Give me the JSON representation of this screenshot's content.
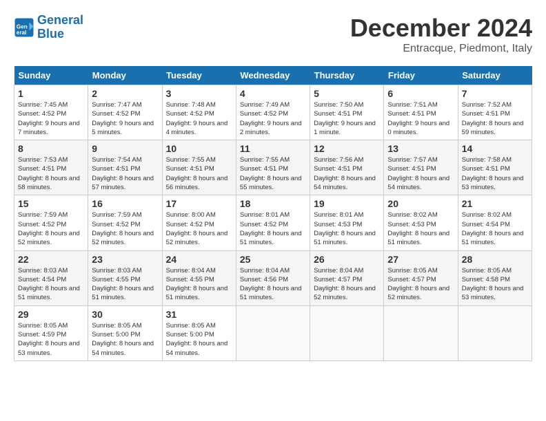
{
  "logo": {
    "line1": "General",
    "line2": "Blue"
  },
  "title": "December 2024",
  "subtitle": "Entracque, Piedmont, Italy",
  "weekdays": [
    "Sunday",
    "Monday",
    "Tuesday",
    "Wednesday",
    "Thursday",
    "Friday",
    "Saturday"
  ],
  "weeks": [
    [
      {
        "day": "1",
        "info": "Sunrise: 7:45 AM\nSunset: 4:52 PM\nDaylight: 9 hours and 7 minutes."
      },
      {
        "day": "2",
        "info": "Sunrise: 7:47 AM\nSunset: 4:52 PM\nDaylight: 9 hours and 5 minutes."
      },
      {
        "day": "3",
        "info": "Sunrise: 7:48 AM\nSunset: 4:52 PM\nDaylight: 9 hours and 4 minutes."
      },
      {
        "day": "4",
        "info": "Sunrise: 7:49 AM\nSunset: 4:52 PM\nDaylight: 9 hours and 2 minutes."
      },
      {
        "day": "5",
        "info": "Sunrise: 7:50 AM\nSunset: 4:51 PM\nDaylight: 9 hours and 1 minute."
      },
      {
        "day": "6",
        "info": "Sunrise: 7:51 AM\nSunset: 4:51 PM\nDaylight: 9 hours and 0 minutes."
      },
      {
        "day": "7",
        "info": "Sunrise: 7:52 AM\nSunset: 4:51 PM\nDaylight: 8 hours and 59 minutes."
      }
    ],
    [
      {
        "day": "8",
        "info": "Sunrise: 7:53 AM\nSunset: 4:51 PM\nDaylight: 8 hours and 58 minutes."
      },
      {
        "day": "9",
        "info": "Sunrise: 7:54 AM\nSunset: 4:51 PM\nDaylight: 8 hours and 57 minutes."
      },
      {
        "day": "10",
        "info": "Sunrise: 7:55 AM\nSunset: 4:51 PM\nDaylight: 8 hours and 56 minutes."
      },
      {
        "day": "11",
        "info": "Sunrise: 7:55 AM\nSunset: 4:51 PM\nDaylight: 8 hours and 55 minutes."
      },
      {
        "day": "12",
        "info": "Sunrise: 7:56 AM\nSunset: 4:51 PM\nDaylight: 8 hours and 54 minutes."
      },
      {
        "day": "13",
        "info": "Sunrise: 7:57 AM\nSunset: 4:51 PM\nDaylight: 8 hours and 54 minutes."
      },
      {
        "day": "14",
        "info": "Sunrise: 7:58 AM\nSunset: 4:51 PM\nDaylight: 8 hours and 53 minutes."
      }
    ],
    [
      {
        "day": "15",
        "info": "Sunrise: 7:59 AM\nSunset: 4:52 PM\nDaylight: 8 hours and 52 minutes."
      },
      {
        "day": "16",
        "info": "Sunrise: 7:59 AM\nSunset: 4:52 PM\nDaylight: 8 hours and 52 minutes."
      },
      {
        "day": "17",
        "info": "Sunrise: 8:00 AM\nSunset: 4:52 PM\nDaylight: 8 hours and 52 minutes."
      },
      {
        "day": "18",
        "info": "Sunrise: 8:01 AM\nSunset: 4:52 PM\nDaylight: 8 hours and 51 minutes."
      },
      {
        "day": "19",
        "info": "Sunrise: 8:01 AM\nSunset: 4:53 PM\nDaylight: 8 hours and 51 minutes."
      },
      {
        "day": "20",
        "info": "Sunrise: 8:02 AM\nSunset: 4:53 PM\nDaylight: 8 hours and 51 minutes."
      },
      {
        "day": "21",
        "info": "Sunrise: 8:02 AM\nSunset: 4:54 PM\nDaylight: 8 hours and 51 minutes."
      }
    ],
    [
      {
        "day": "22",
        "info": "Sunrise: 8:03 AM\nSunset: 4:54 PM\nDaylight: 8 hours and 51 minutes."
      },
      {
        "day": "23",
        "info": "Sunrise: 8:03 AM\nSunset: 4:55 PM\nDaylight: 8 hours and 51 minutes."
      },
      {
        "day": "24",
        "info": "Sunrise: 8:04 AM\nSunset: 4:55 PM\nDaylight: 8 hours and 51 minutes."
      },
      {
        "day": "25",
        "info": "Sunrise: 8:04 AM\nSunset: 4:56 PM\nDaylight: 8 hours and 51 minutes."
      },
      {
        "day": "26",
        "info": "Sunrise: 8:04 AM\nSunset: 4:57 PM\nDaylight: 8 hours and 52 minutes."
      },
      {
        "day": "27",
        "info": "Sunrise: 8:05 AM\nSunset: 4:57 PM\nDaylight: 8 hours and 52 minutes."
      },
      {
        "day": "28",
        "info": "Sunrise: 8:05 AM\nSunset: 4:58 PM\nDaylight: 8 hours and 53 minutes."
      }
    ],
    [
      {
        "day": "29",
        "info": "Sunrise: 8:05 AM\nSunset: 4:59 PM\nDaylight: 8 hours and 53 minutes."
      },
      {
        "day": "30",
        "info": "Sunrise: 8:05 AM\nSunset: 5:00 PM\nDaylight: 8 hours and 54 minutes."
      },
      {
        "day": "31",
        "info": "Sunrise: 8:05 AM\nSunset: 5:00 PM\nDaylight: 8 hours and 54 minutes."
      },
      {
        "day": "",
        "info": ""
      },
      {
        "day": "",
        "info": ""
      },
      {
        "day": "",
        "info": ""
      },
      {
        "day": "",
        "info": ""
      }
    ]
  ]
}
